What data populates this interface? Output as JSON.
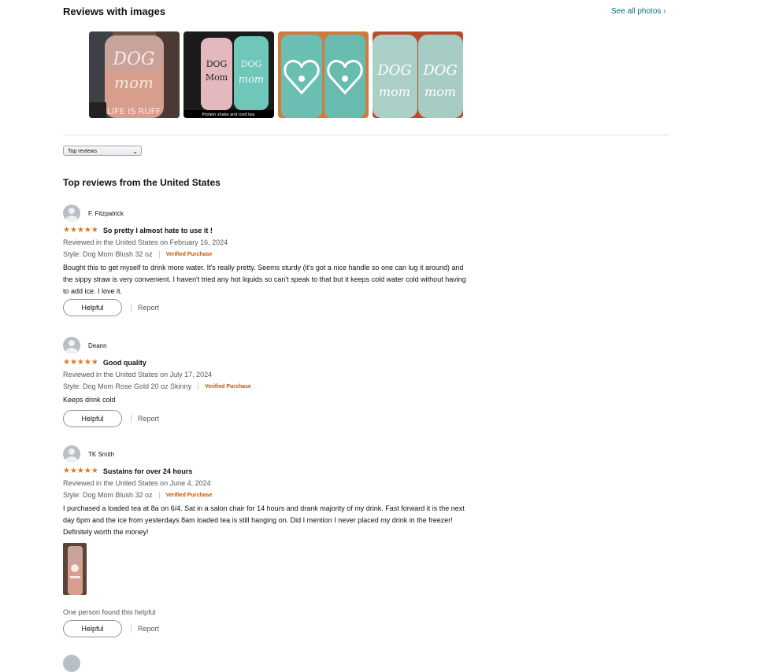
{
  "images_section": {
    "heading": "Reviews with images",
    "see_all": "See all photos",
    "see_all_chevron": "›",
    "thumbs": [
      {
        "caption": ""
      },
      {
        "caption": "Protein shake and iced tea"
      },
      {
        "caption": ""
      },
      {
        "caption": ""
      }
    ]
  },
  "sort": {
    "value": "Top reviews",
    "chevron": "⌄"
  },
  "top_heading": "Top reviews from the United States",
  "reviews": [
    {
      "name": "F. Fitzpatrick",
      "stars": "★★★★★",
      "title": "So pretty I almost hate to use it !",
      "date": "Reviewed in the United States on February 16, 2024",
      "style": "Style: Dog Mom Blush 32 oz",
      "verified": "Verified Purchase",
      "body": "Bought this to get myself to drink more water. It's really pretty. Seems sturdy (it's got a nice handle so one can lug it around) and the sippy straw is very convenient. I haven't tried any hot liquids so can't speak to that but it keeps cold water cold without having to add ice. I love it.",
      "helpful": "Helpful",
      "report": "Report"
    },
    {
      "name": "Deann",
      "stars": "★★★★★",
      "title": "Good quality",
      "date": "Reviewed in the United States on July 17, 2024",
      "style": "Style: Dog Mom Rose Gold 20 oz Skinny",
      "verified": "Verified Purchase",
      "body": "Keeps drink cold",
      "helpful": "Helpful",
      "report": "Report"
    },
    {
      "name": "TK Smith",
      "stars": "★★★★★",
      "title": "Sustains for over 24 hours",
      "date": "Reviewed in the United States on June 4, 2024",
      "style": "Style: Dog Mom Blush 32 oz",
      "verified": "Verified Purchase",
      "body": "I purchased a loaded tea at 8a on 6/4. Sat in a salon chair for 14 hours and drank majority of my drink. Fast forward it is the next day 6pm and the ice from yesterdays 8am loaded tea is still hanging on. Did I mention I never placed my drink in the freezer! Definitely worth the money!",
      "helpful_count": "One person found this helpful",
      "helpful": "Helpful",
      "report": "Report"
    }
  ],
  "colors": {
    "link": "#007185",
    "star": "#de7921",
    "verified": "#c45500"
  }
}
